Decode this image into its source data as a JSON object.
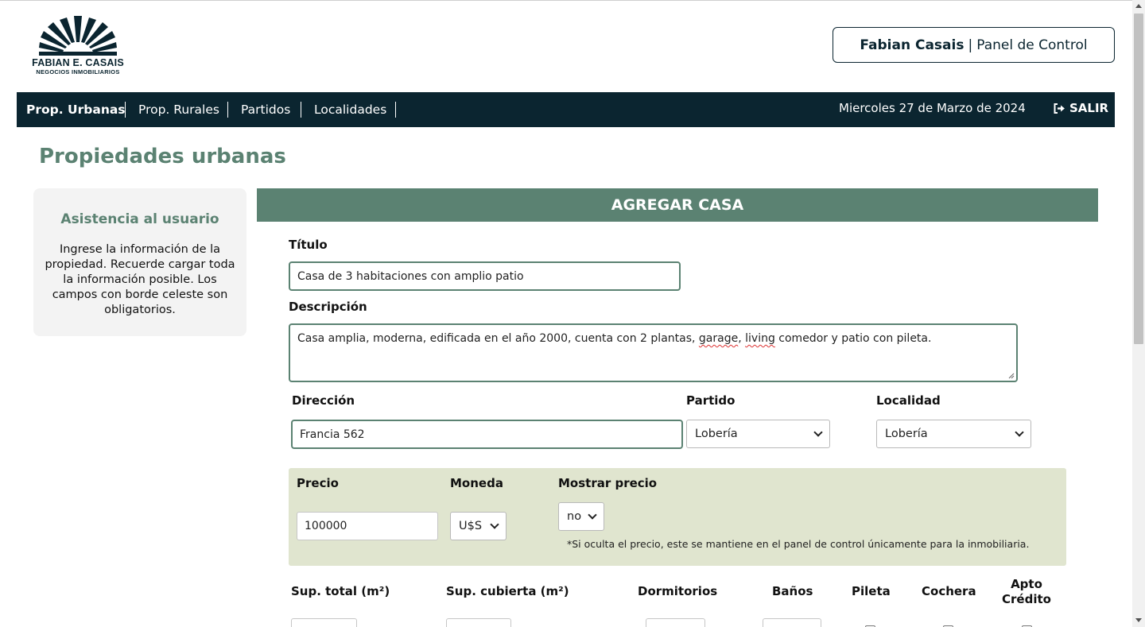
{
  "brand": {
    "name": "FABIAN E. CASAIS",
    "subtitle": "NEGOCIOS INMOBILIARIOS"
  },
  "header_panel": {
    "owner": "Fabian Casais",
    "separator": "|",
    "label": "Panel de Control"
  },
  "nav": {
    "items": [
      {
        "label": "Prop. Urbanas",
        "active": true
      },
      {
        "label": "Prop. Rurales",
        "active": false
      },
      {
        "label": "Partidos",
        "active": false
      },
      {
        "label": "Localidades",
        "active": false
      }
    ],
    "date": "Miercoles 27 de Marzo de 2024",
    "logout": "SALIR",
    "icon": "sign-out-icon"
  },
  "page_title": "Propiedades urbanas",
  "help": {
    "title": "Asistencia al usuario",
    "text": "Ingrese la información de la propiedad. Recuerde cargar toda la información posible. Los campos con borde celeste son obligatorios."
  },
  "form": {
    "header": "AGREGAR CASA",
    "titulo_label": "Título",
    "titulo_value": "Casa de 3 habitaciones con amplio patio",
    "descripcion_label": "Descripción",
    "descripcion_parts": {
      "a": "Casa amplia, moderna, edificada en el año 2000, cuenta con 2 plantas, ",
      "b": "garage",
      "c": ", ",
      "d": "living",
      "e": " comedor y patio con pileta."
    },
    "direccion_label": "Dirección",
    "direccion_value": "Francia 562",
    "partido_label": "Partido",
    "partido_value": "Lobería",
    "localidad_label": "Localidad",
    "localidad_value": "Lobería",
    "precio_label": "Precio",
    "precio_value": "100000",
    "moneda_label": "Moneda",
    "moneda_value": "U$S",
    "mostrar_label": "Mostrar precio",
    "mostrar_value": "no",
    "precio_note": "*Si oculta el precio, este se mantiene en el panel de control únicamente para la inmobiliaria.",
    "sup_total_label": "Sup. total (m²)",
    "sup_cubierta_label": "Sup. cubierta (m²)",
    "dormitorios_label": "Dormitorios",
    "banos_label": "Baños",
    "pileta_label": "Pileta",
    "cochera_label": "Cochera",
    "apto_label_1": "Apto",
    "apto_label_2": "Crédito"
  },
  "colors": {
    "navy": "#0b2530",
    "green": "#5b8272",
    "price_bg": "#e0e5cf"
  }
}
